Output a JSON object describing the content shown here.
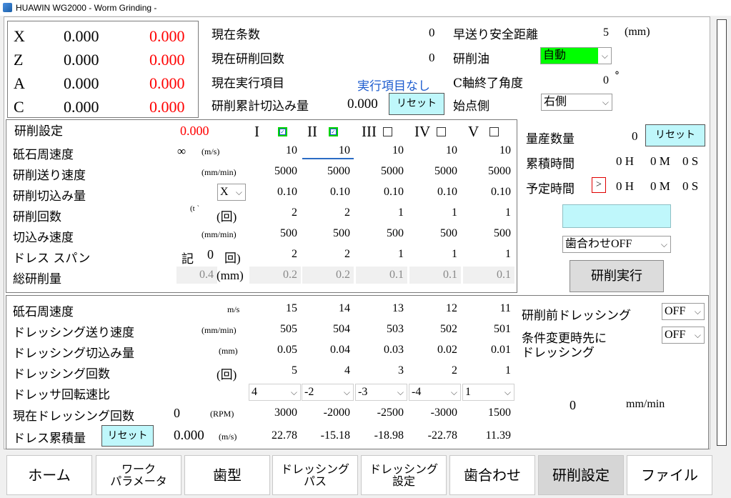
{
  "window": {
    "title": "HUAWIN WG2000 - Worm Grinding -"
  },
  "axes": [
    {
      "name": "X",
      "pos": "0.000",
      "target": "0.000"
    },
    {
      "name": "Z",
      "pos": "0.000",
      "target": "0.000"
    },
    {
      "name": "A",
      "pos": "0.000",
      "target": "0.000"
    },
    {
      "name": "C",
      "pos": "0.000",
      "target": "0.000"
    }
  ],
  "status": {
    "current_line_label": "現在条数",
    "current_line_value": "0",
    "grind_count_label": "現在研削回数",
    "grind_count_value": "0",
    "exec_item_label": "現在実行項目",
    "exec_item_value": "実行項目なし",
    "cum_cut_label": "研削累計切込み量",
    "cum_cut_value": "0.000",
    "reset": "リセット"
  },
  "settings_right": {
    "rapid_label": "早送り安全距離",
    "rapid_value": "5",
    "rapid_unit": "(mm)",
    "oil_label": "研削油",
    "oil_value": "自動",
    "c_end_label": "C軸終了角度",
    "c_end_value": "0",
    "c_end_unit": "°",
    "start_label": "始点側",
    "start_value": "右側"
  },
  "grind": {
    "title": "研削設定",
    "offset": "0.000",
    "columns": [
      {
        "label": "I",
        "checked": true
      },
      {
        "label": "II",
        "checked": true
      },
      {
        "label": "III",
        "checked": false
      },
      {
        "label": "IV",
        "checked": false
      },
      {
        "label": "V",
        "checked": false
      }
    ],
    "rows": [
      {
        "label": "砥石周速度",
        "extra": "∞",
        "unit": "(m/s)",
        "values": [
          "10",
          "10",
          "10",
          "10",
          "10"
        ]
      },
      {
        "label": "研削送り速度",
        "extra": "",
        "unit": "(mm/min)",
        "values": [
          "5000",
          "5000",
          "5000",
          "5000",
          "5000"
        ]
      },
      {
        "label": "研削切込み量",
        "extra": "X",
        "unit": "",
        "values": [
          "0.10",
          "0.10",
          "0.10",
          "0.10",
          "0.10"
        ]
      },
      {
        "label": "研削回数",
        "extra": "(t ˋ",
        "unit": "(回)",
        "values": [
          "2",
          "2",
          "1",
          "1",
          "1"
        ]
      },
      {
        "label": "切込み速度",
        "extra": "",
        "unit": "(mm/min)",
        "values": [
          "500",
          "500",
          "500",
          "500",
          "500"
        ]
      },
      {
        "label": "ドレス スパン",
        "extra": "記",
        "extra2": "0",
        "unit": "回)",
        "values": [
          "2",
          "2",
          "1",
          "1",
          "1"
        ]
      },
      {
        "label": "総研削量",
        "extra": "0.4",
        "unit": "(mm)",
        "values": [
          "0.2",
          "0.2",
          "0.1",
          "0.1",
          "0.1"
        ]
      }
    ]
  },
  "production": {
    "count_label": "量産数量",
    "count_value": "0",
    "reset": "リセット",
    "cum_time_label": "累積時間",
    "cum_h": "0 H",
    "cum_m": "0 M",
    "cum_s": "0 S",
    "plan_time_label": "予定時間",
    "plan_btn": ">",
    "plan_h": "0 H",
    "plan_m": "0 M",
    "plan_s": "0 S",
    "mesh_value": "歯合わせOFF",
    "run_button": "研削実行"
  },
  "dressing": {
    "rows": [
      {
        "label": "砥石周速度",
        "unit": "m/s",
        "values": [
          "15",
          "14",
          "13",
          "12",
          "11"
        ]
      },
      {
        "label": "ドレッシング送り速度",
        "unit": "(mm/min)",
        "values": [
          "505",
          "504",
          "503",
          "502",
          "501"
        ]
      },
      {
        "label": "ドレッシング切込み量",
        "unit": "(mm)",
        "values": [
          "0.05",
          "0.04",
          "0.03",
          "0.02",
          "0.01"
        ]
      },
      {
        "label": "ドレッシング回数",
        "unit": "(回)",
        "values": [
          "5",
          "4",
          "3",
          "2",
          "1"
        ]
      }
    ],
    "ratio_label": "ドレッサ回転速比",
    "ratio_values": [
      "4",
      "-2",
      "-3",
      "-4",
      "1"
    ],
    "current_label": "現在ドレッシング回数",
    "current_value": "0",
    "rpm_unit": "(RPM)",
    "rpm_values": [
      "3000",
      "-2000",
      "-2500",
      "-3000",
      "1500"
    ],
    "cum_label": "ドレス累積量",
    "reset": "リセット",
    "cum_value": "0.000",
    "ms_unit": "(m/s)",
    "ms_values": [
      "22.78",
      "-15.18",
      "-18.98",
      "-22.78",
      "11.39"
    ],
    "pre_label": "研削前ドレッシング",
    "pre_value": "OFF",
    "cond_label1": "条件変更時先に",
    "cond_label2": "ドレッシング",
    "cond_value": "OFF",
    "speed_value": "0",
    "speed_unit": "mm/min"
  },
  "nav": [
    "ホーム",
    "ワーク|パラメータ",
    "歯型",
    "ドレッシング|パス",
    "ドレッシング|設定",
    "歯合わせ",
    "研削設定",
    "ファイル"
  ],
  "colors": {
    "highlight_cyan": "#bff7fb",
    "oil_green": "#00ff00",
    "axis_red": "#ff0000",
    "link_blue": "#1d5ccf"
  }
}
